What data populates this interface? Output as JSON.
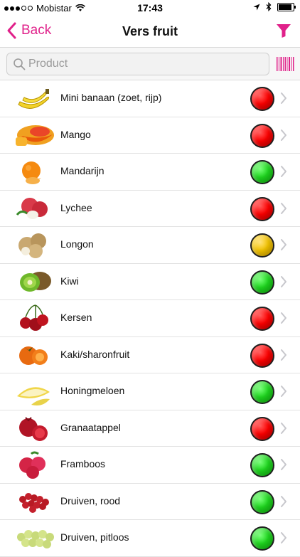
{
  "status_bar": {
    "carrier": "Mobistar",
    "time": "17:43",
    "battery_level": 0.92
  },
  "nav": {
    "back_label": "Back",
    "title": "Vers fruit"
  },
  "search": {
    "placeholder": "Product"
  },
  "colors": {
    "accent": "#e0218a",
    "red": "#ff0000",
    "green": "#1fd81f",
    "yellow": "#f4c400"
  },
  "items": [
    {
      "label": "Mini banaan (zoet, rijp)",
      "status": "red",
      "icon": "banana-icon"
    },
    {
      "label": "Mango",
      "status": "red",
      "icon": "mango-icon"
    },
    {
      "label": "Mandarijn",
      "status": "green",
      "icon": "mandarin-icon"
    },
    {
      "label": "Lychee",
      "status": "red",
      "icon": "lychee-icon"
    },
    {
      "label": "Longon",
      "status": "yellow",
      "icon": "longan-icon"
    },
    {
      "label": "Kiwi",
      "status": "green",
      "icon": "kiwi-icon"
    },
    {
      "label": "Kersen",
      "status": "red",
      "icon": "cherry-icon"
    },
    {
      "label": "Kaki/sharonfruit",
      "status": "red",
      "icon": "persimmon-icon"
    },
    {
      "label": "Honingmeloen",
      "status": "green",
      "icon": "melon-icon"
    },
    {
      "label": "Granaatappel",
      "status": "red",
      "icon": "pomegranate-icon"
    },
    {
      "label": "Framboos",
      "status": "green",
      "icon": "raspberry-icon"
    },
    {
      "label": "Druiven, rood",
      "status": "green",
      "icon": "red-grapes-icon"
    },
    {
      "label": "Druiven, pitloos",
      "status": "green",
      "icon": "green-grapes-icon"
    }
  ]
}
